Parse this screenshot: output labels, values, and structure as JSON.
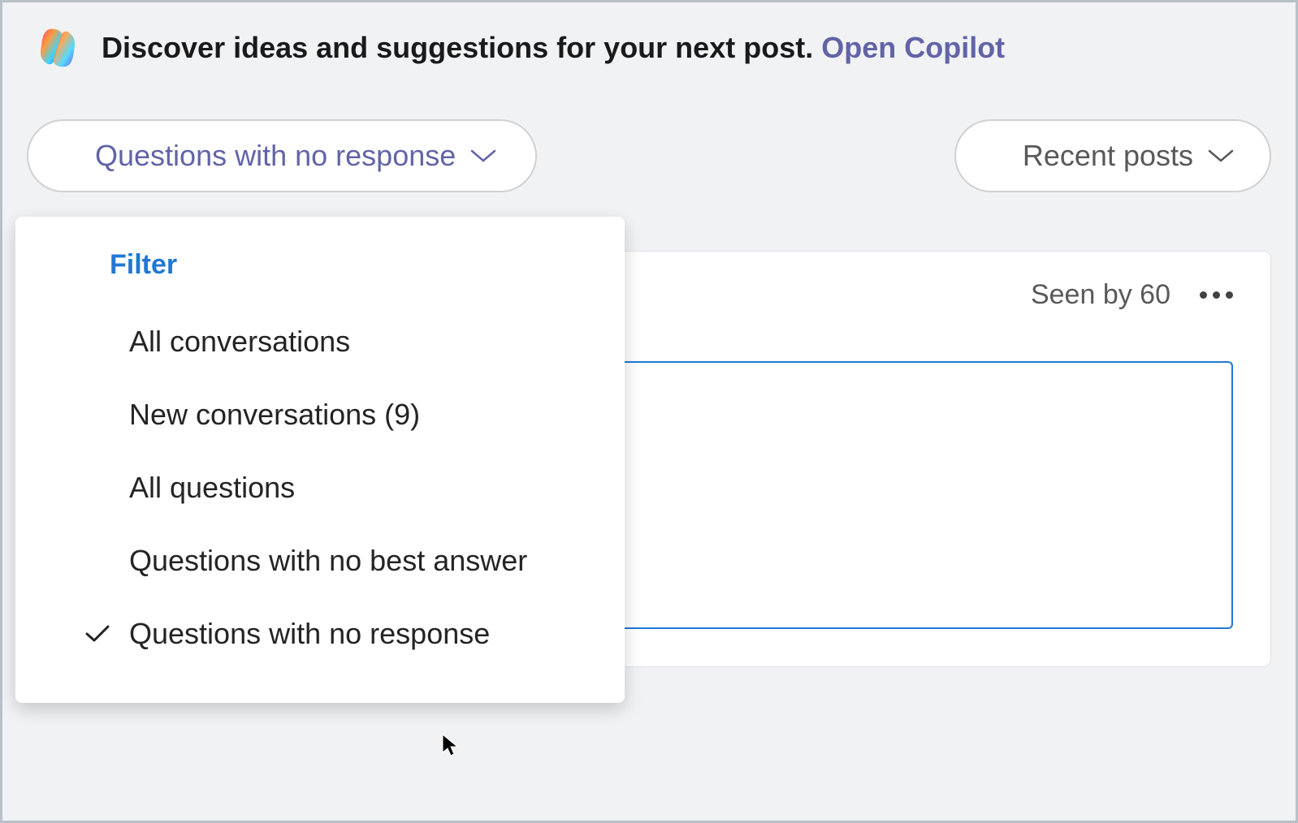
{
  "banner": {
    "text": "Discover ideas and suggestions for your next post. ",
    "link_label": "Open Copilot"
  },
  "filter_dropdown": {
    "selected_label": "Questions with no response",
    "header": "Filter",
    "items": [
      {
        "label": "All conversations",
        "checked": false
      },
      {
        "label": "New conversations (9)",
        "checked": false
      },
      {
        "label": "All questions",
        "checked": false
      },
      {
        "label": "Questions with no best answer",
        "checked": false
      },
      {
        "label": "Questions with no response",
        "checked": true
      }
    ]
  },
  "sort_dropdown": {
    "selected_label": "Recent posts"
  },
  "post": {
    "seen_by_label": "Seen by 60"
  }
}
